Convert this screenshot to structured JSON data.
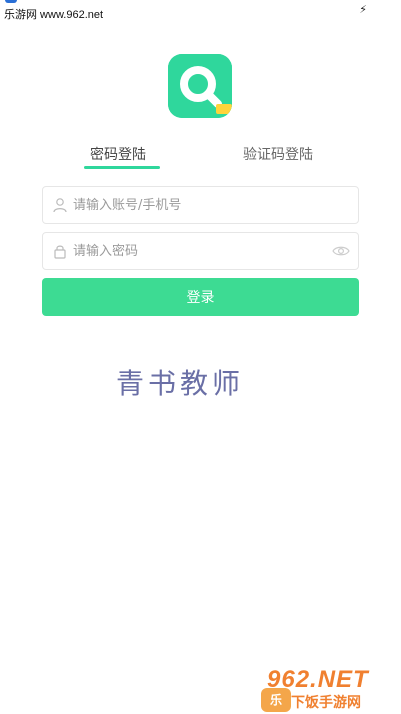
{
  "status_bar": {
    "site": "乐游网 www.962.net",
    "charging_icon": "lightning-bolt-icon"
  },
  "app": {
    "logo_icon": "magnifier-q-logo-icon",
    "logo_color": "#2fd79c"
  },
  "tabs": [
    {
      "label": "密码登陆",
      "active": true
    },
    {
      "label": "验证码登陆",
      "active": false
    }
  ],
  "form": {
    "account_placeholder": "请输入账号/手机号",
    "password_placeholder": "请输入密码",
    "account_icon": "user-icon",
    "password_icon": "lock-icon",
    "toggle_icon": "eye-icon",
    "login_label": "登录",
    "button_color": "#3ddb93"
  },
  "caption": "青书教师",
  "watermark": {
    "top": "962.NET",
    "bottom": "下饭手游网",
    "badge": "乐"
  }
}
